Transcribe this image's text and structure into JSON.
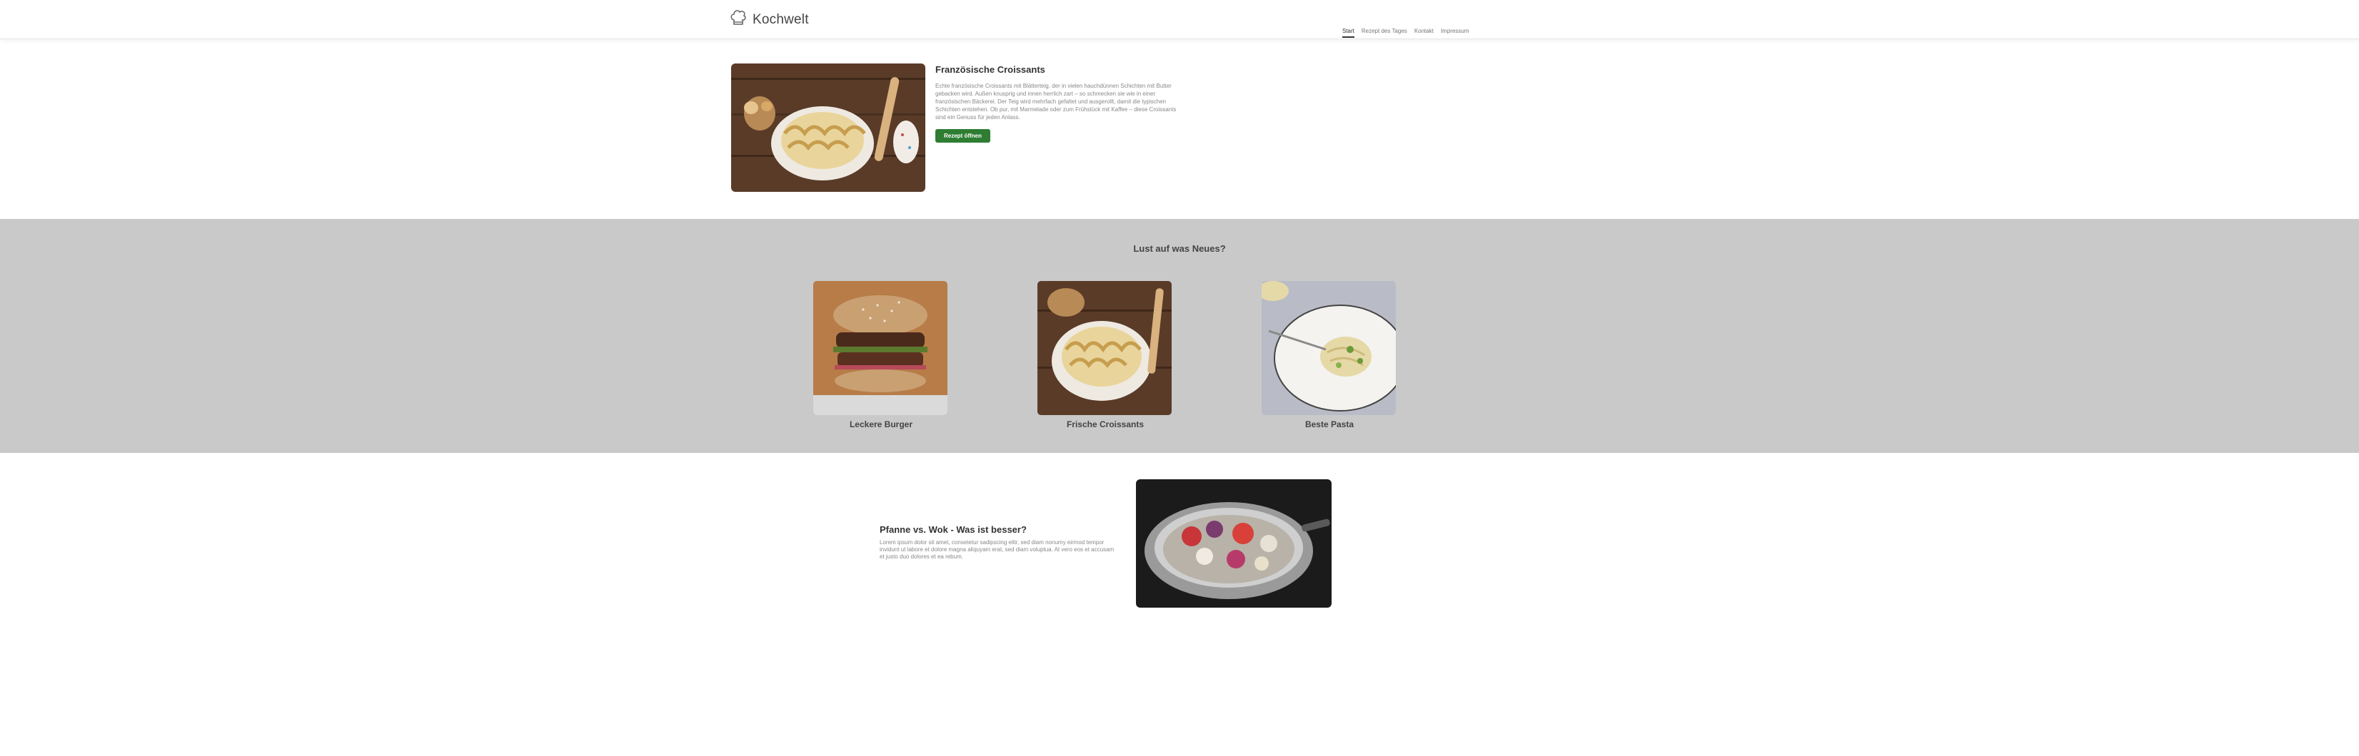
{
  "brand": {
    "name": "Kochwelt",
    "logo_icon": "chef-hat-icon"
  },
  "nav": {
    "items": [
      {
        "label": "Start"
      },
      {
        "label": "Rezept des Tages"
      },
      {
        "label": "Kontakt"
      },
      {
        "label": "Impressum"
      }
    ],
    "active_index": 0
  },
  "hero": {
    "image_icon": "croissant-dough-photo",
    "title": "Französische Croissants",
    "description": "Echte französische Croissants mit Blätterteig, der in vielen hauchdünnen Schichten mit Butter gebacken wird. Außen knusprig und innen herrlich zart – so schmecken sie wie in einer französischen Bäckerei. Der Teig wird mehrfach gefaltet und ausgerollt, damit die typischen Schichten entstehen. Ob pur, mit Marmelade oder zum Frühstück mit Kaffee – diese Croissants sind ein Genuss für jeden Anlass.",
    "button_label": "Rezept öffnen",
    "button_color": "#2e7d32"
  },
  "discover": {
    "title": "Lust auf was Neues?",
    "background": "#c9c9c9",
    "cards": [
      {
        "caption": "Leckere Burger",
        "image_icon": "burger-photo"
      },
      {
        "caption": "Frische Croissants",
        "image_icon": "croissant-dough-photo"
      },
      {
        "caption": "Beste Pasta",
        "image_icon": "pasta-photo"
      }
    ]
  },
  "article": {
    "title": "Pfanne vs. Wok - Was ist besser?",
    "description": "Lorem ipsum dolor sit amet, consetetur sadipscing elitr, sed diam nonumy eirmod tempor invidunt ut labore et dolore magna aliquyam erat, sed diam voluptua. At vero eos et accusam et justo duo dolores et ea rebum.",
    "image_icon": "wok-vegetables-photo"
  }
}
